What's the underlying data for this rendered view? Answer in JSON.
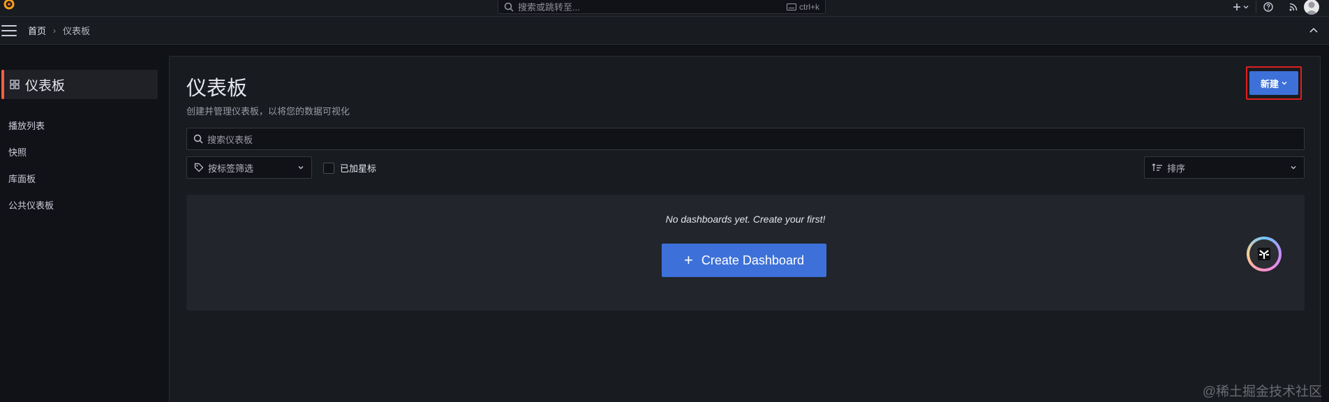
{
  "topbar": {
    "search_placeholder": "搜索或跳转至...",
    "shortcut": "ctrl+k"
  },
  "breadcrumb": {
    "home": "首页",
    "separator": "›",
    "current": "仪表板"
  },
  "sidebar": {
    "header": "仪表板",
    "items": [
      {
        "label": "播放列表"
      },
      {
        "label": "快照"
      },
      {
        "label": "库面板"
      },
      {
        "label": "公共仪表板"
      }
    ]
  },
  "main": {
    "title": "仪表板",
    "subtitle": "创建并管理仪表板，以将您的数据可视化",
    "new_button": "新建",
    "search_placeholder": "搜索仪表板",
    "tag_filter": "按标签筛选",
    "starred_label": "已加星标",
    "sort_label": "排序",
    "empty_message": "No dashboards yet. Create your first!",
    "create_button": "Create Dashboard"
  },
  "watermark": "@稀土掘金技术社区",
  "colors": {
    "accent": "#3d71d9",
    "active_bar": "#f55f3e",
    "highlight_border": "#e02020",
    "background": "#111217",
    "panel": "#181b1f"
  }
}
